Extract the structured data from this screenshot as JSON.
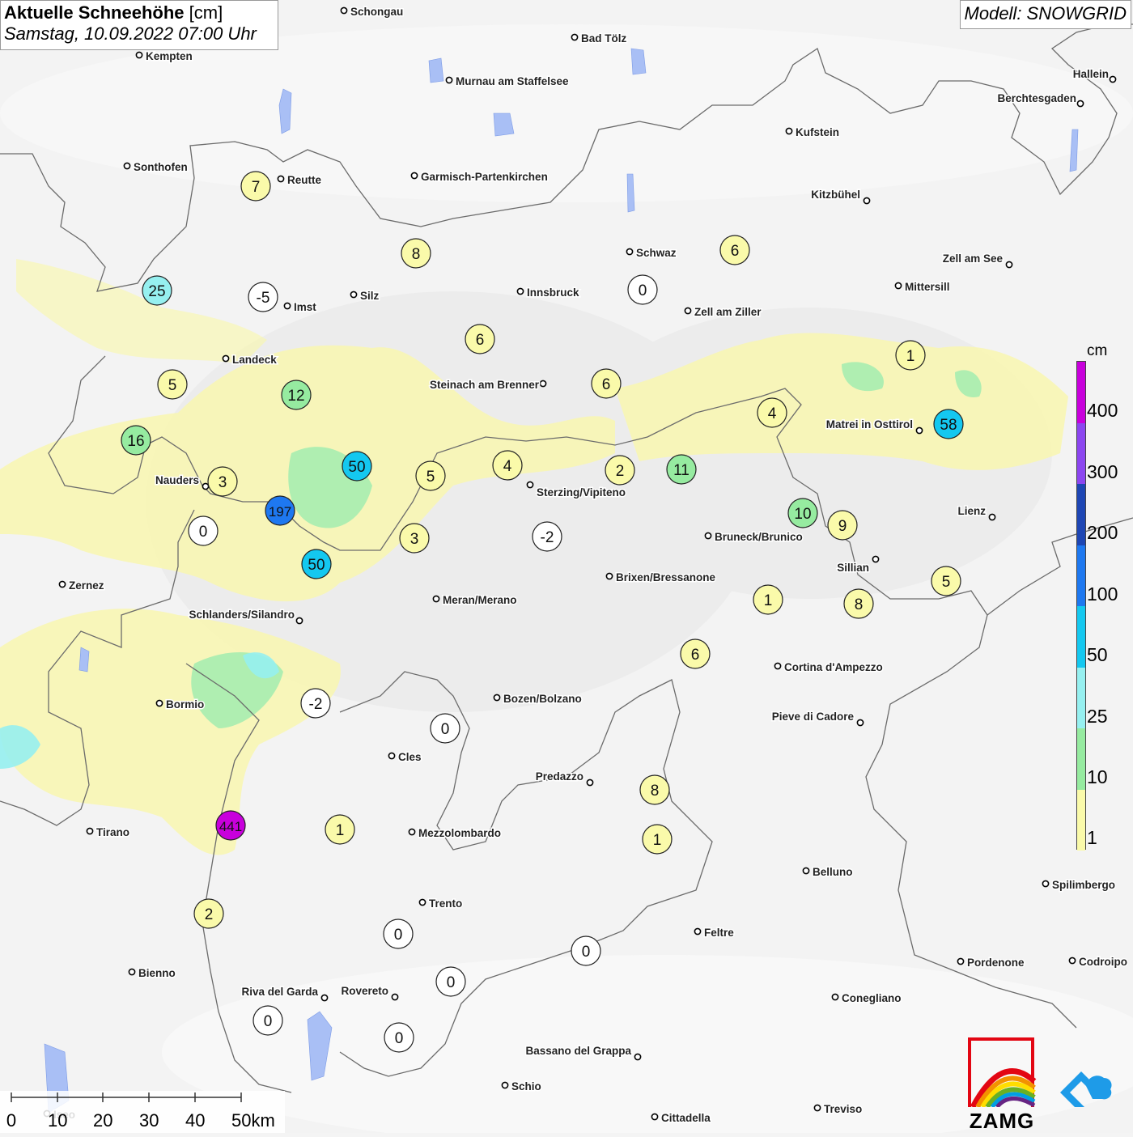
{
  "title": {
    "main": "Aktuelle Schneehöhe",
    "unit": "[cm]",
    "date": "Samstag, 10.09.2022 07:00 Uhr"
  },
  "model": "Modell: SNOWGRID",
  "legend": {
    "unit": "cm",
    "labels": [
      "400",
      "300",
      "200",
      "100",
      "50",
      "25",
      "10",
      "1"
    ],
    "colors": [
      "#c800dc",
      "#8c46f0",
      "#1e46b4",
      "#1e78f0",
      "#14c8f0",
      "#96f0f0",
      "#96eba0",
      "#fafaaa"
    ]
  },
  "cities": [
    {
      "name": "Schongau"
    },
    {
      "name": "Bad Tölz"
    },
    {
      "name": "Kempten"
    },
    {
      "name": "Murnau am Staffelsee"
    },
    {
      "name": "Hallein"
    },
    {
      "name": "Berchtesgaden"
    },
    {
      "name": "Kufstein"
    },
    {
      "name": "Sonthofen"
    },
    {
      "name": "Reutte"
    },
    {
      "name": "Garmisch-Partenkirchen"
    },
    {
      "name": "Kitzbühel"
    },
    {
      "name": "Schwaz"
    },
    {
      "name": "Zell am See"
    },
    {
      "name": "Innsbruck"
    },
    {
      "name": "Mittersill"
    },
    {
      "name": "Silz"
    },
    {
      "name": "Imst"
    },
    {
      "name": "Zell am Ziller"
    },
    {
      "name": "Landeck"
    },
    {
      "name": "Steinach am Brenner"
    },
    {
      "name": "Matrei in Osttirol"
    },
    {
      "name": "Nauders"
    },
    {
      "name": "Sterzing/Vipiteno"
    },
    {
      "name": "Lienz"
    },
    {
      "name": "Bruneck/Brunico"
    },
    {
      "name": "Sillian"
    },
    {
      "name": "Zernez"
    },
    {
      "name": "Brixen/Bressanone"
    },
    {
      "name": "Meran/Merano"
    },
    {
      "name": "Schlanders/Silandro"
    },
    {
      "name": "Cortina d'Ampezzo"
    },
    {
      "name": "Bormio"
    },
    {
      "name": "Bozen/Bolzano"
    },
    {
      "name": "Pieve di Cadore"
    },
    {
      "name": "Cles"
    },
    {
      "name": "Predazzo"
    },
    {
      "name": "Tirano"
    },
    {
      "name": "Mezzolombardo"
    },
    {
      "name": "Belluno"
    },
    {
      "name": "Spilimbergo"
    },
    {
      "name": "Trento"
    },
    {
      "name": "Feltre"
    },
    {
      "name": "Pordenone"
    },
    {
      "name": "Codroipo"
    },
    {
      "name": "Bienno"
    },
    {
      "name": "Riva del Garda"
    },
    {
      "name": "Rovereto"
    },
    {
      "name": "Conegliano"
    },
    {
      "name": "Bassano del Grappa"
    },
    {
      "name": "Schio"
    },
    {
      "name": "Treviso"
    },
    {
      "name": "Cittadella"
    },
    {
      "name": "Iseo"
    }
  ],
  "stations": [
    {
      "value": "7"
    },
    {
      "value": "8"
    },
    {
      "value": "6"
    },
    {
      "value": "25"
    },
    {
      "value": "-5"
    },
    {
      "value": "0"
    },
    {
      "value": "6"
    },
    {
      "value": "1"
    },
    {
      "value": "5"
    },
    {
      "value": "12"
    },
    {
      "value": "6"
    },
    {
      "value": "4"
    },
    {
      "value": "58"
    },
    {
      "value": "16"
    },
    {
      "value": "50"
    },
    {
      "value": "4"
    },
    {
      "value": "5"
    },
    {
      "value": "2"
    },
    {
      "value": "11"
    },
    {
      "value": "3"
    },
    {
      "value": "197"
    },
    {
      "value": "10"
    },
    {
      "value": "0"
    },
    {
      "value": "9"
    },
    {
      "value": "3"
    },
    {
      "value": "-2"
    },
    {
      "value": "50"
    },
    {
      "value": "5"
    },
    {
      "value": "1"
    },
    {
      "value": "8"
    },
    {
      "value": "6"
    },
    {
      "value": "-2"
    },
    {
      "value": "0"
    },
    {
      "value": "8"
    },
    {
      "value": "441"
    },
    {
      "value": "1"
    },
    {
      "value": "1"
    },
    {
      "value": "2"
    },
    {
      "value": "0"
    },
    {
      "value": "0"
    },
    {
      "value": "0"
    },
    {
      "value": "0"
    },
    {
      "value": "0"
    }
  ],
  "scalebar": {
    "ticks": [
      "0",
      "10",
      "20",
      "30",
      "40",
      "50km"
    ]
  },
  "logos": {
    "zamg": "ZAMG"
  },
  "icons": [
    "zamg-logo-icon",
    "cloud-logo-icon"
  ]
}
